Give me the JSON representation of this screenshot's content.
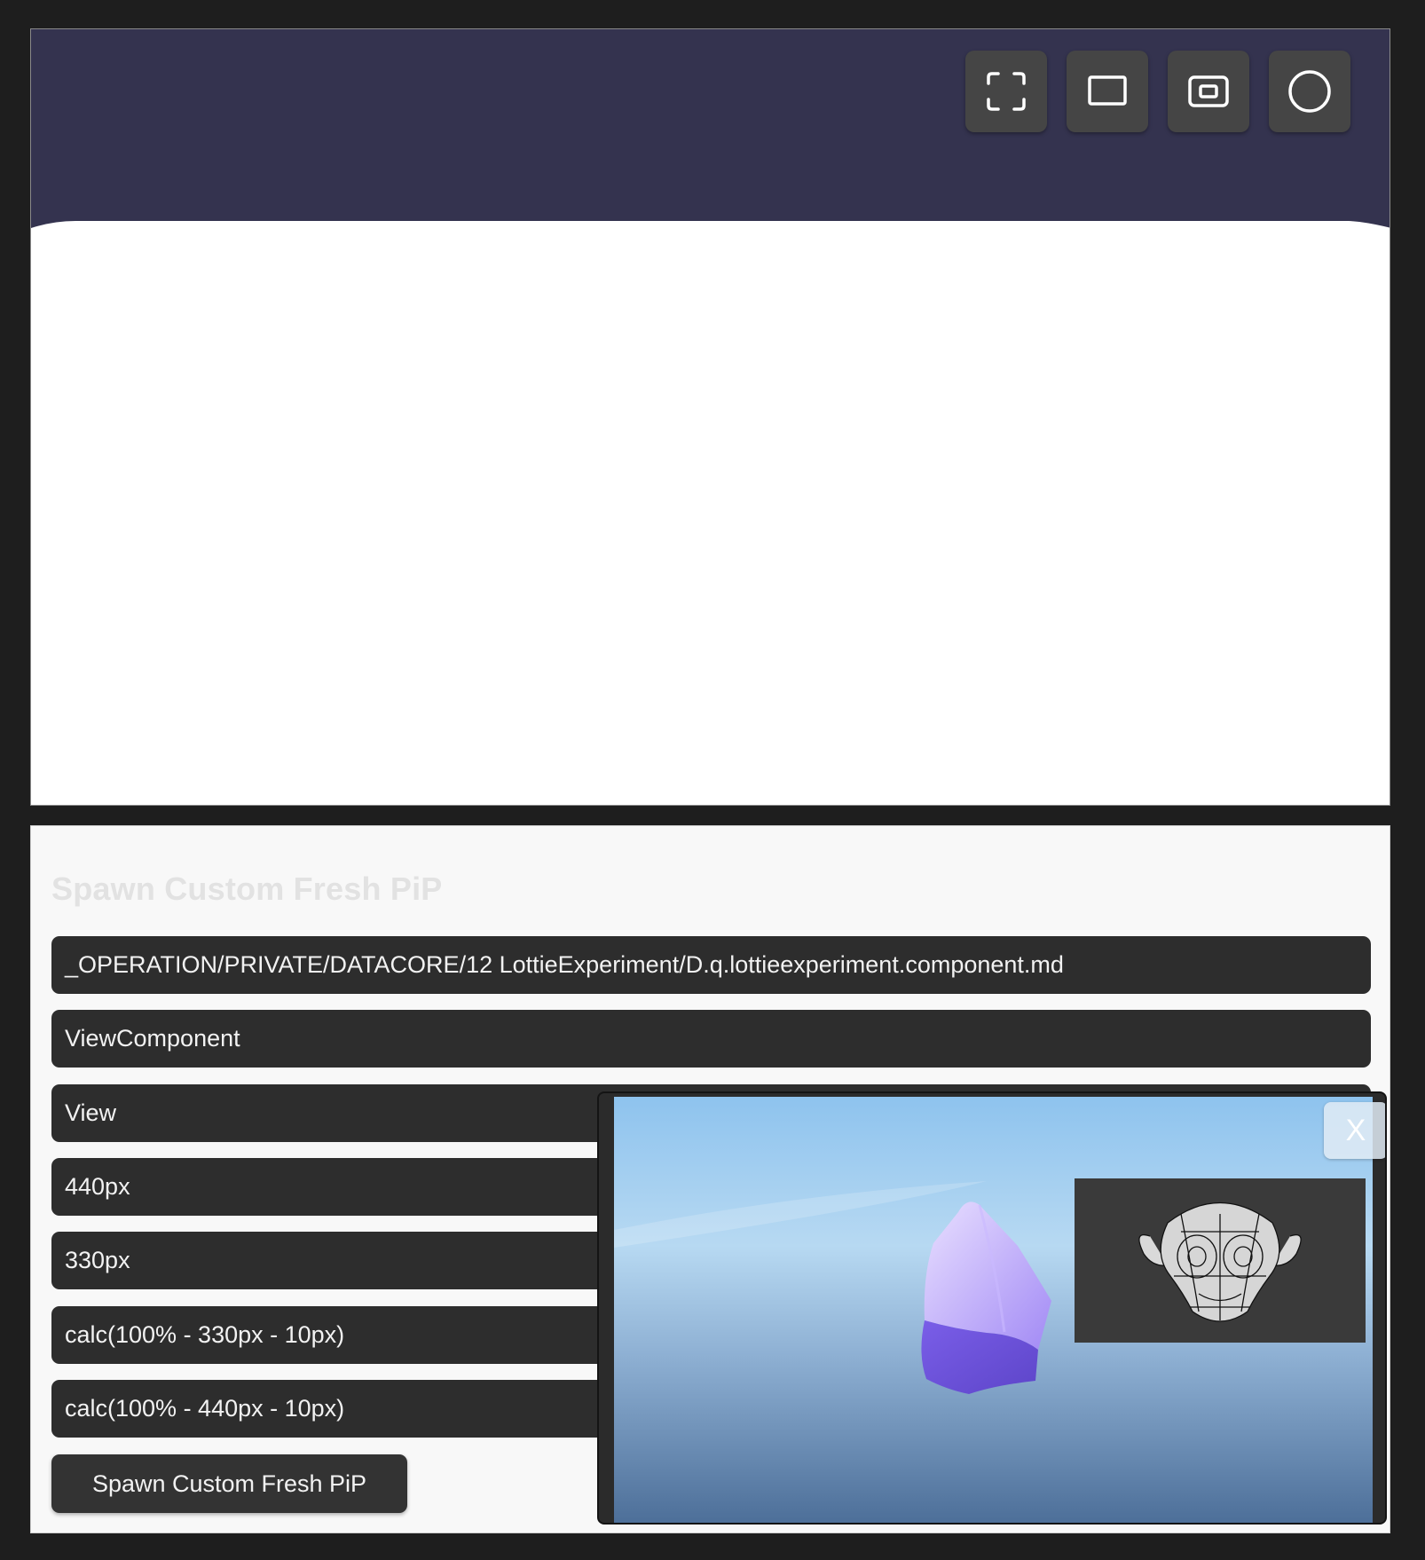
{
  "viewer": {
    "header_color": "#34334f",
    "toolbar": [
      {
        "icon": "fullscreen-corners-icon",
        "name": "fullscreen-button"
      },
      {
        "icon": "rectangle-icon",
        "name": "window-button"
      },
      {
        "icon": "picture-in-picture-icon",
        "name": "pip-button"
      },
      {
        "icon": "circle-icon",
        "name": "circle-button"
      }
    ]
  },
  "form": {
    "title": "Spawn Custom Fresh PiP",
    "fields": [
      "_OPERATION/PRIVATE/DATACORE/12 LottieExperiment/D.q.lottieexperiment.component.md",
      "ViewComponent",
      "View",
      "440px",
      "330px",
      "calc(100% - 330px - 10px)",
      "calc(100% - 440px - 10px)"
    ],
    "button_label": "Spawn Custom Fresh PiP"
  },
  "pip": {
    "close_label": "X",
    "accent": "#8b6cf0"
  }
}
